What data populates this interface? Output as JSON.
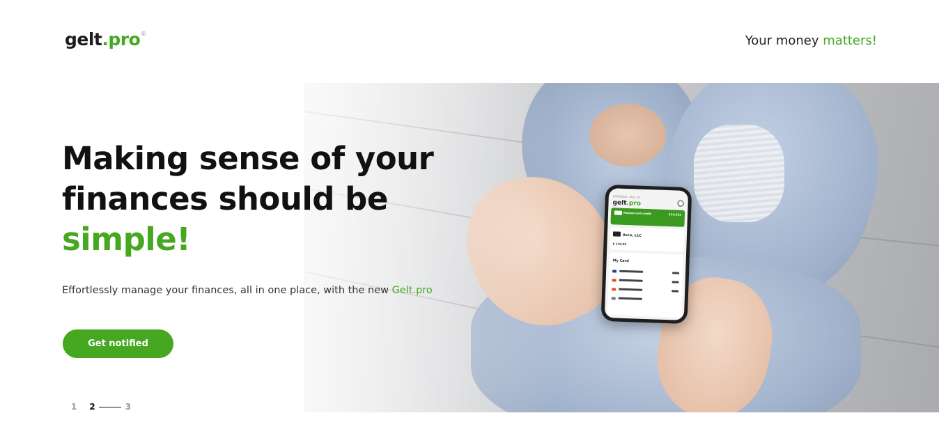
{
  "brand": {
    "logo_part1": "gelt",
    "logo_part2": ".pro",
    "logo_mark": "©",
    "accent_color": "#45a820"
  },
  "header": {
    "tagline_prefix": "Your money ",
    "tagline_accent": "matters!"
  },
  "hero": {
    "headline_line1": "Making sense of your",
    "headline_line2": "finances should be",
    "headline_accent": "simple!",
    "subtext_prefix": "Effortlessly manage your finances, all in one place, with the new ",
    "subtext_accent": "Gelt.pro",
    "cta_label": "Get notified",
    "image_description_icon": "phone-in-hands-photo"
  },
  "phone_screen": {
    "date": "SATURDAY, AUG 26",
    "logo_part1": "gelt",
    "logo_part2": ".pro",
    "card1_name": "Mastercard credit",
    "card1_value": "$10,632",
    "card2_name": "Asco, LLC",
    "card2_amount": "$ 110,99",
    "list_title": "My Card"
  },
  "pager": {
    "pages": [
      "1",
      "2",
      "3"
    ],
    "active_index": 1
  }
}
